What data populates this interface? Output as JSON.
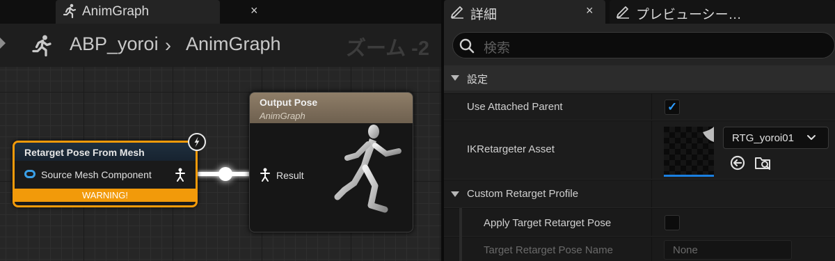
{
  "graph_editor": {
    "tab": {
      "title": "AnimGraph",
      "close": "×"
    },
    "breadcrumb": {
      "root": "ABP_yoroi",
      "separator": "›",
      "current": "AnimGraph"
    },
    "zoom_label": "ズーム -2",
    "nodes": {
      "retarget": {
        "title": "Retarget Pose From Mesh",
        "input_pin": "Source Mesh Component",
        "warning": "WARNING!",
        "accent_color": "#f29a0a"
      },
      "output": {
        "title": "Output Pose",
        "subtitle": "AnimGraph",
        "input_pin": "Result"
      }
    }
  },
  "details_panel": {
    "tabs": [
      {
        "label": "詳細",
        "close": "×"
      },
      {
        "label": "プレビューシー…"
      }
    ],
    "search": {
      "placeholder": "検索"
    },
    "section": "設定",
    "properties": {
      "use_attached_parent": {
        "label": "Use Attached Parent",
        "checked": true
      },
      "ik_retargeter_asset": {
        "label": "IKRetargeter Asset",
        "value": "RTG_yoroi01"
      },
      "custom_retarget_profile": {
        "label": "Custom Retarget Profile"
      },
      "apply_target_retarget_pose": {
        "label": "Apply Target Retarget Pose",
        "checked": false
      },
      "target_retarget_pose_name": {
        "label": "Target Retarget Pose Name",
        "value": "None"
      }
    },
    "check_mark": "✓",
    "accent_color": "#2d9cff"
  }
}
